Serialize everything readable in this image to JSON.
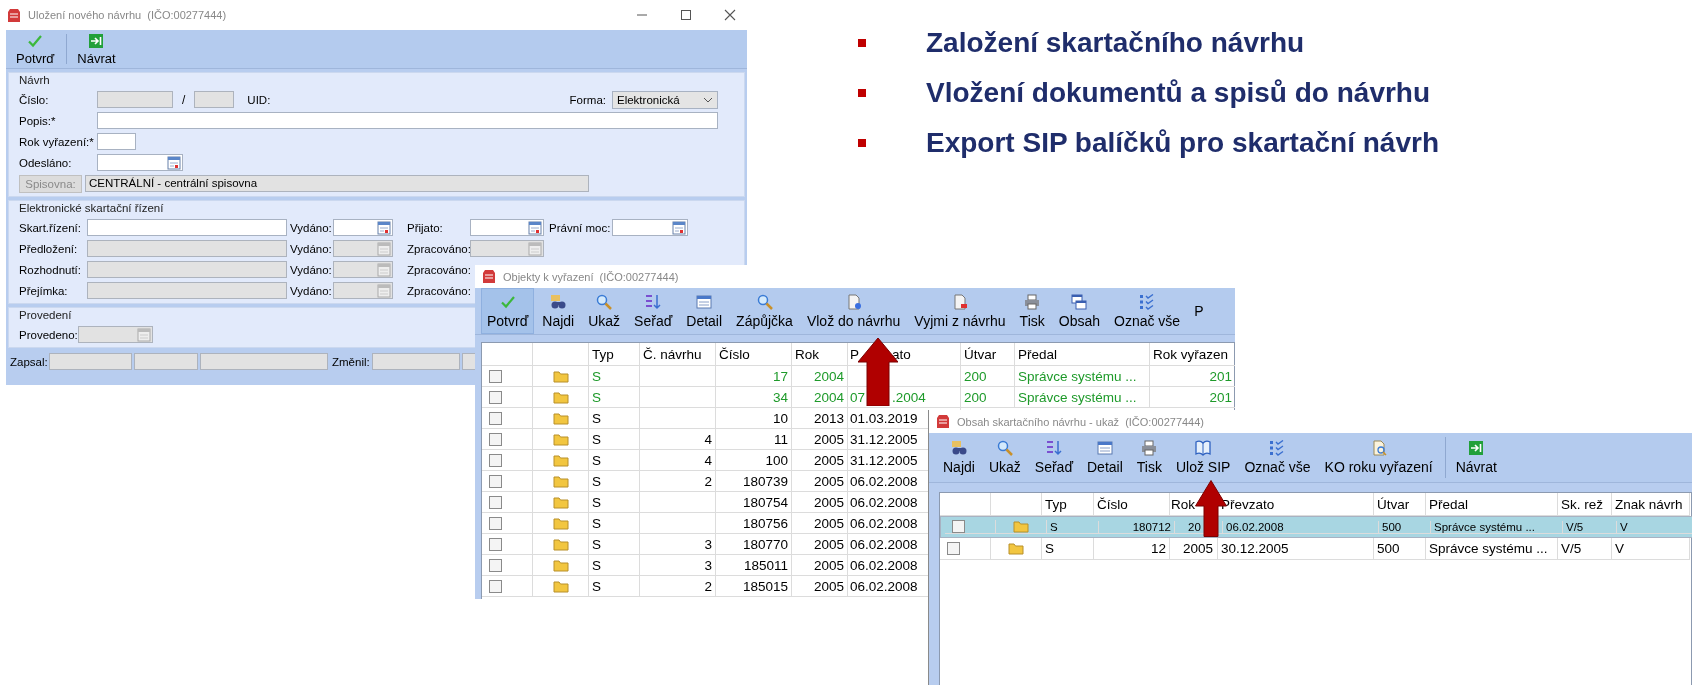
{
  "slide": {
    "bullets": [
      "Založení skartačního návrhu",
      "Vložení dokumentů a spisů do návrhu",
      "Export SIP balíčků pro skartační návrh"
    ]
  },
  "form_window": {
    "title": "Uložení nového návrhu  (IČO:00277444)",
    "toolbar": [
      {
        "label": "Potvrď"
      },
      {
        "label": "Návrat"
      }
    ],
    "navrh": {
      "title": "Návrh",
      "cislo_label": "Číslo:",
      "cislo_disabled": true,
      "slash": "/",
      "uid_label": "UID:",
      "forma_label": "Forma:",
      "forma_value": "Elektronická",
      "popis_label": "Popis:*",
      "rok_label": "Rok vyřazení:*",
      "odeslano_label": "Odesláno:",
      "spisovna_button": "Spisovna:",
      "spisovna_disabled": true,
      "spisovna_value": "CENTRÁLNÍ - centrální spisovna"
    },
    "rizeni": {
      "title": "Elektronické skartační řízení",
      "rows": [
        {
          "label": "Skart.řízení:",
          "disabled": false,
          "vydano": "Vydáno:",
          "second": "Přijato:",
          "third": "Právní moc:"
        },
        {
          "label": "Předložení:",
          "disabled": true,
          "vydano": "Vydáno:",
          "second": "Zpracováno:"
        },
        {
          "label": "Rozhodnutí:",
          "disabled": true,
          "vydano": "Vydáno:",
          "second": "Zpracováno:"
        },
        {
          "label": "Přejímka:",
          "disabled": true,
          "vydano": "Vydáno:",
          "second": "Zpracováno:"
        }
      ]
    },
    "provedeni": {
      "title": "Provedení",
      "label": "Provedeno:",
      "disabled": true
    },
    "footer": {
      "zapsal": "Zapsal:",
      "zmenil": "Změnil:"
    }
  },
  "objects_window": {
    "title": "Objekty k vyřazení  (IČO:00277444)",
    "toolbar": [
      {
        "label": "Potvrď",
        "highlighted": true
      },
      {
        "label": "Najdi",
        "highlighted": false
      },
      {
        "label": "Ukaž",
        "highlighted": false
      },
      {
        "label": "Seřaď",
        "highlighted": false
      },
      {
        "label": "Detail",
        "highlighted": false
      },
      {
        "label": "Zápůjčka",
        "highlighted": false
      },
      {
        "label": "Vlož do návrhu",
        "highlighted": false
      },
      {
        "label": "Vyjmi z návrhu",
        "highlighted": false
      },
      {
        "label": "Tisk",
        "highlighted": false
      },
      {
        "label": "Obsah",
        "highlighted": false
      },
      {
        "label": "Označ vše",
        "highlighted": false
      },
      {
        "label": "P",
        "highlighted": false
      }
    ],
    "columns": [
      {
        "label": "Typ"
      },
      {
        "label": "Č. návrhu"
      },
      {
        "label": "Číslo"
      },
      {
        "label": "Rok"
      },
      {
        "parts": [
          "P",
          "ato"
        ]
      },
      {
        "label": "Útvar"
      },
      {
        "label": "Předal"
      },
      {
        "label": "Rok vyřazen"
      }
    ],
    "rows": [
      {
        "checked": false,
        "color": "#1e9a2a",
        "typ": "S",
        "cislo": "17",
        "rok": "2004",
        "utvar": "200",
        "predal": "Správce systému ...",
        "rok_vyrazeni": "201"
      },
      {
        "checked": false,
        "color": "#1e9a2a",
        "typ": "S",
        "cislo": "34",
        "rok": "2004",
        "prevzato_parts": [
          "07",
          ".2004"
        ],
        "utvar": "200",
        "predal": "Správce systému ...",
        "rok_vyrazeni": "201"
      },
      {
        "checked": false,
        "color": "#000000",
        "typ": "S",
        "cislo": "10",
        "rok": "2013",
        "prevzato": "01.03.2019"
      },
      {
        "checked": false,
        "color": "#000000",
        "typ": "S",
        "cislo_navrhu": "4",
        "cislo": "11",
        "rok": "2005",
        "prevzato": "31.12.2005"
      },
      {
        "checked": false,
        "color": "#000000",
        "typ": "S",
        "cislo_navrhu": "4",
        "cislo": "100",
        "rok": "2005",
        "prevzato": "31.12.2005"
      },
      {
        "checked": false,
        "color": "#000000",
        "typ": "S",
        "cislo_navrhu": "2",
        "cislo": "180739",
        "rok": "2005",
        "prevzato": "06.02.2008"
      },
      {
        "checked": false,
        "color": "#000000",
        "typ": "S",
        "cislo": "180754",
        "rok": "2005",
        "prevzato": "06.02.2008"
      },
      {
        "checked": false,
        "color": "#000000",
        "typ": "S",
        "cislo": "180756",
        "rok": "2005",
        "prevzato": "06.02.2008"
      },
      {
        "checked": false,
        "color": "#000000",
        "typ": "S",
        "cislo_navrhu": "3",
        "cislo": "180770",
        "rok": "2005",
        "prevzato": "06.02.2008"
      },
      {
        "checked": false,
        "color": "#000000",
        "typ": "S",
        "cislo_navrhu": "3",
        "cislo": "185011",
        "rok": "2005",
        "prevzato": "06.02.2008"
      },
      {
        "checked": false,
        "color": "#000000",
        "typ": "S",
        "cislo_navrhu": "2",
        "cislo": "185015",
        "rok": "2005",
        "prevzato": "06.02.2008"
      }
    ]
  },
  "content_window": {
    "title": "Obsah skartačního návrhu - ukaž  (IČO:00277444)",
    "toolbar_groups": [
      {
        "items": [
          "Najdi",
          "Ukaž",
          "Seřaď",
          "Detail",
          "Tisk",
          "Ulož SIP",
          "Označ vše",
          "KO roku vyřazení"
        ]
      },
      {
        "items": [
          "Návrat"
        ]
      }
    ],
    "columns": [
      "Typ",
      "Číslo",
      "Rok",
      "Převzato",
      "Útvar",
      "Předal",
      "Sk. rež",
      "Znak návrh"
    ],
    "rows": [
      {
        "selected": true,
        "checked": false,
        "typ": "S",
        "cislo": "180712",
        "rok": "20",
        "prevzato": "06.02.2008",
        "utvar": "500",
        "predal": "Správce systému ...",
        "sk_rez": "V/5",
        "znak": "V"
      },
      {
        "selected": false,
        "checked": false,
        "typ": "S",
        "cislo": "12",
        "rok": "2005",
        "prevzato": "30.12.2005",
        "utvar": "500",
        "predal": "Správce systému ...",
        "sk_rez": "V/5",
        "znak": "V"
      }
    ]
  }
}
